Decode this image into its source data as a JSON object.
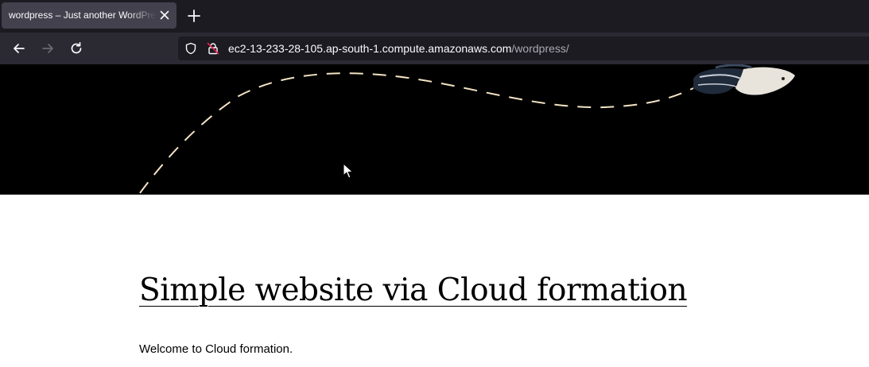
{
  "browser": {
    "tab": {
      "title": "wordpress – Just another WordPress site",
      "close_icon": "close-icon"
    },
    "new_tab_icon": "plus-icon",
    "nav": {
      "back_icon": "arrow-left-icon",
      "forward_icon": "arrow-right-icon",
      "reload_icon": "reload-icon"
    },
    "urlbar": {
      "shield_icon": "shield-icon",
      "insecure_icon": "insecure-lock-icon",
      "host": "ec2-13-233-28-105.ap-south-1.compute.amazonaws.com",
      "path": "/wordpress/"
    }
  },
  "page": {
    "post": {
      "title": "Simple website via Cloud formation",
      "body": "Welcome to Cloud formation."
    }
  },
  "colors": {
    "tabstrip": "#1c1b22",
    "active_tab": "#42414d",
    "navbar": "#2b2a33",
    "hero_background": "#000000",
    "flight_path": "#f3e3c4"
  }
}
